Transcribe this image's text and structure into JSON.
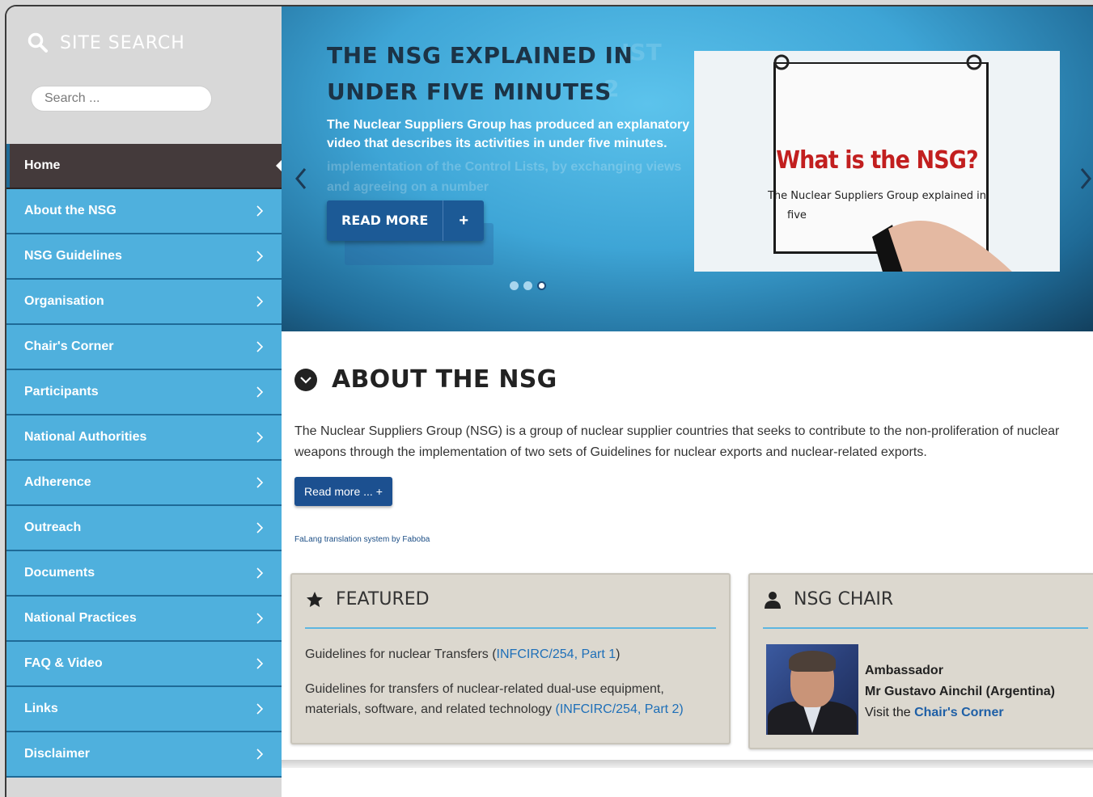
{
  "sidebar": {
    "search_title": "SITE SEARCH",
    "search_placeholder": "Search ...",
    "items": [
      {
        "label": "Home"
      },
      {
        "label": "About the NSG"
      },
      {
        "label": "NSG Guidelines"
      },
      {
        "label": "Organisation"
      },
      {
        "label": "Chair's Corner"
      },
      {
        "label": "Participants"
      },
      {
        "label": "National Authorities"
      },
      {
        "label": "Adherence"
      },
      {
        "label": "Outreach"
      },
      {
        "label": "Documents"
      },
      {
        "label": "National Practices"
      },
      {
        "label": "FAQ & Video"
      },
      {
        "label": "Links"
      },
      {
        "label": "Disclaimer"
      }
    ]
  },
  "hero": {
    "title_line1": "THE NSG EXPLAINED IN",
    "title_line2": "UNDER FIVE MINUTES",
    "ghost_title_1": "IST",
    "ghost_title_2": "2",
    "text": "The Nuclear Suppliers Group has produced an explanatory video that describes its activities in under five minutes.",
    "ghost_text": "implementation of the Control Lists, by exchanging views and agreeing on a number",
    "button_label": "READ MORE",
    "button_plus": "+",
    "slide_heading": "What is the NSG?",
    "slide_sub": "The Nuclear Suppliers Group explained in",
    "slide_sub2": "five",
    "active_dot": 3,
    "dot_count": 3
  },
  "about": {
    "title": "ABOUT THE NSG",
    "text": "The Nuclear Suppliers Group (NSG) is a group of nuclear supplier countries that seeks to contribute to the non-proliferation of nuclear weapons through the implementation of two sets of Guidelines for nuclear exports and nuclear-related exports.",
    "read_more": "Read more ... +",
    "falang": "FaLang translation system by Faboba"
  },
  "featured": {
    "title": "FEATURED",
    "line1_text": "Guidelines for nuclear Transfers (",
    "line1_link": "INFCIRC/254, Part 1",
    "line1_end": ")",
    "line2_text": "Guidelines for transfers of nuclear-related dual-use equipment, materials, software, and related technology ",
    "line2_link": "(INFCIRC/254, Part 2)"
  },
  "chair": {
    "title": "NSG CHAIR",
    "role": "Ambassador",
    "name": "Mr Gustavo Ainchil (Argentina)",
    "visit_text": "Visit the ",
    "visit_link": "Chair's Corner"
  },
  "colors": {
    "nav_blue": "#4fb0dd",
    "nav_active": "#443a3b",
    "button_blue": "#1c5a96",
    "link_blue": "#1e6fb8"
  }
}
